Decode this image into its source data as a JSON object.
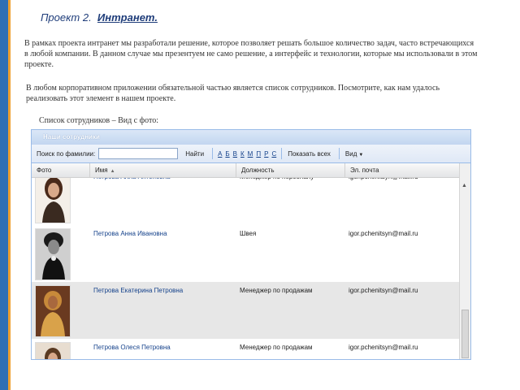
{
  "title": {
    "prefix": "Проект 2.",
    "link": "Интранет."
  },
  "paragraphs": [
    "В рамках проекта интранет мы разработали решение, которое позволяет решать большое количество задач, часто встречающихся в любой компании. В данном случае мы презентуем не само решение, а интерфейс и технологии, которые мы использовали в этом проекте.",
    "В любом корпоративном приложении обязательной частью является список сотрудников. Посмотрите, как нам удалось реализовать этот элемент в нашем проекте."
  ],
  "caption": "Список сотрудников – Вид с фото:",
  "app": {
    "header": "Наши сотрудники",
    "toolbar": {
      "search_label": "Поиск по фамилии:",
      "search_value": "",
      "find_button": "Найти",
      "letters": [
        "А",
        "Б",
        "В",
        "К",
        "М",
        "П",
        "Р",
        "С"
      ],
      "show_all": "Показать всех",
      "view": "Вид"
    },
    "columns": [
      "Фото",
      "Имя",
      "Должность",
      "Эл. почта"
    ],
    "rows": [
      {
        "name": "Петрова Алла Антоновна",
        "position": "Менеджер по персоналу",
        "email": "igor.pchenitsyn@mail.ru"
      },
      {
        "name": "Петрова Анна Ивановна",
        "position": "Швея",
        "email": "igor.pchenitsyn@mail.ru"
      },
      {
        "name": "Петрова Екатерина Петровна",
        "position": "Менеджер по продажам",
        "email": "igor.pchenitsyn@mail.ru"
      },
      {
        "name": "Петрова Олеся Петровна",
        "position": "Менеджер по продажам",
        "email": "igor.pchenitsyn@mail.ru"
      }
    ]
  },
  "colors": {
    "accent": "#2f6fb5",
    "secondary": "#f0a030",
    "link": "#15428b"
  }
}
